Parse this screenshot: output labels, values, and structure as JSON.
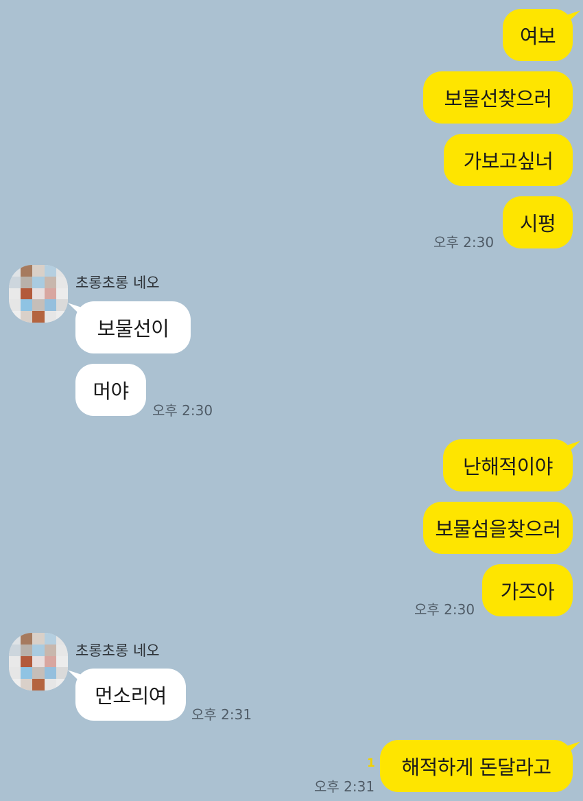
{
  "messages": [
    {
      "text": "여보",
      "side": "me"
    },
    {
      "text": "보물선찾으러",
      "side": "me"
    },
    {
      "text": "가보고싶너",
      "side": "me"
    },
    {
      "text": "시펑",
      "side": "me"
    },
    {
      "text": "보물선이",
      "side": "them"
    },
    {
      "text": "머야",
      "side": "them"
    },
    {
      "text": "난해적이야",
      "side": "me"
    },
    {
      "text": "보물섬을찾으러",
      "side": "me"
    },
    {
      "text": "가즈아",
      "side": "me"
    },
    {
      "text": "먼소리여",
      "side": "them"
    },
    {
      "text": "해적하게 돈달라고",
      "side": "me"
    }
  ],
  "times": [
    "오후 2:30",
    "오후 2:30",
    "오후 2:30",
    "오후 2:31",
    "오후 2:31"
  ],
  "sender_name": "초롱초롱 네오",
  "unread_count": "1",
  "colors": {
    "background": "#abc1d1",
    "my_bubble": "#fee500",
    "their_bubble": "#ffffff",
    "unread": "#f2d200"
  }
}
